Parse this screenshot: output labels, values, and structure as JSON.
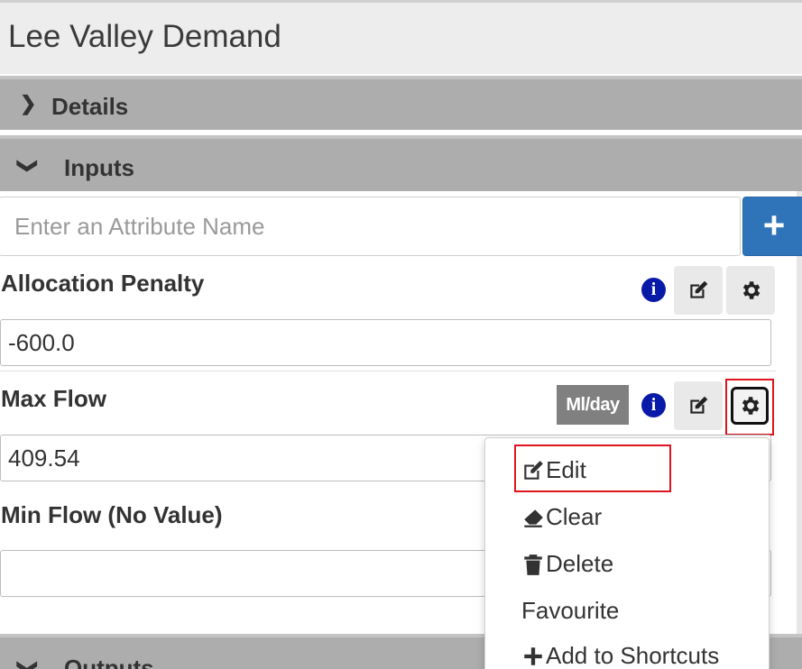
{
  "page": {
    "title": "Lee Valley Demand"
  },
  "sections": {
    "details": {
      "label": "Details",
      "expanded": false
    },
    "inputs": {
      "label": "Inputs",
      "expanded": true
    },
    "outputs": {
      "label": "Outputs",
      "expanded": true
    }
  },
  "search": {
    "placeholder": "Enter an Attribute Name",
    "add_label": "+"
  },
  "attributes": [
    {
      "label": "Allocation Penalty",
      "value": "-600.0",
      "unit": ""
    },
    {
      "label": "Max Flow",
      "value": "409.54",
      "unit": "Ml/day"
    },
    {
      "label": "Min Flow (No Value)",
      "value": "",
      "unit": ""
    }
  ],
  "info_glyph": "i",
  "menu": {
    "items": [
      {
        "label": "Edit",
        "icon": "edit-icon"
      },
      {
        "label": "Clear",
        "icon": "eraser-icon"
      },
      {
        "label": "Delete",
        "icon": "trash-icon"
      },
      {
        "label": "Favourite",
        "icon": ""
      },
      {
        "label": "Add to Shortcuts",
        "icon": "plus-icon"
      }
    ]
  },
  "colors": {
    "accent": "#2f74b9",
    "info": "#0a1aa8",
    "highlight": "#e0141e",
    "section_header": "#adadad"
  }
}
